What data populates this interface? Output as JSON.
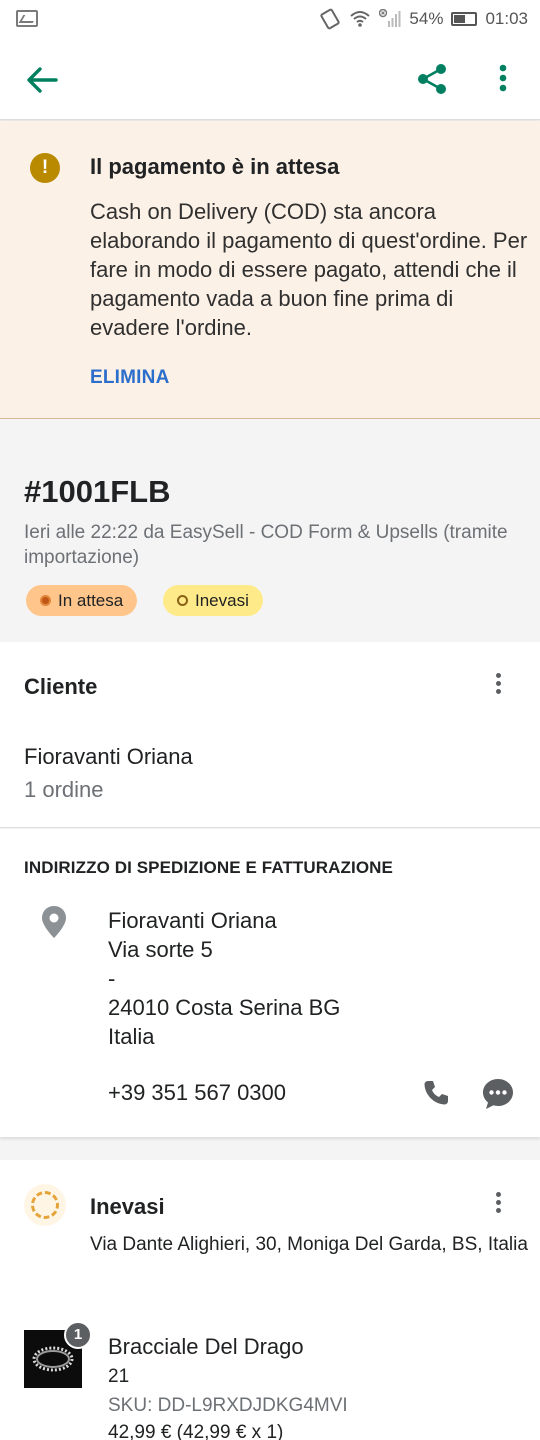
{
  "status_bar": {
    "battery": "54%",
    "time": "01:03",
    "icons": [
      "image-icon",
      "vibrate-icon",
      "wifi-icon",
      "signal-icon",
      "battery-icon"
    ]
  },
  "app_bar": {
    "icons": [
      "back-arrow-icon",
      "share-icon",
      "more-vertical-icon"
    ],
    "accent_color": "#008060"
  },
  "banner": {
    "title": "Il pagamento è in attesa",
    "message": "Cash on Delivery (COD) sta ancora elaborando il pagamento di quest'ordine. Per fare in modo di essere pagato, attendi che il pagamento vada a buon fine prima di evadere l'ordine.",
    "action_label": "ELIMINA",
    "background_color": "#fcf1e6"
  },
  "order": {
    "number": "#1001FLB",
    "meta": "Ieri alle 22:22 da EasySell - COD Form & Upsells (tramite importazione)",
    "badges": [
      "In attesa",
      "Inevasi"
    ]
  },
  "customer": {
    "heading": "Cliente",
    "name": "Fioravanti Oriana",
    "orders": "1 ordine"
  },
  "address": {
    "heading": "INDIRIZZO DI SPEDIZIONE E FATTURAZIONE",
    "lines": [
      "Fioravanti Oriana",
      "Via sorte 5",
      "-",
      "24010 Costa Serina BG",
      "Italia"
    ],
    "phone": "+39 351 567 0300"
  },
  "fulfillment": {
    "heading": "Inevasi",
    "location": "Via Dante Alighieri, 30, Moniga Del Garda, BS, Italia",
    "item": {
      "quantity": "1",
      "title": "Bracciale Del Drago",
      "variant": "21",
      "sku": "SKU: DD-L9RXDJDKG4MVI",
      "price": "42,99 € (42,99 € x 1)"
    }
  }
}
